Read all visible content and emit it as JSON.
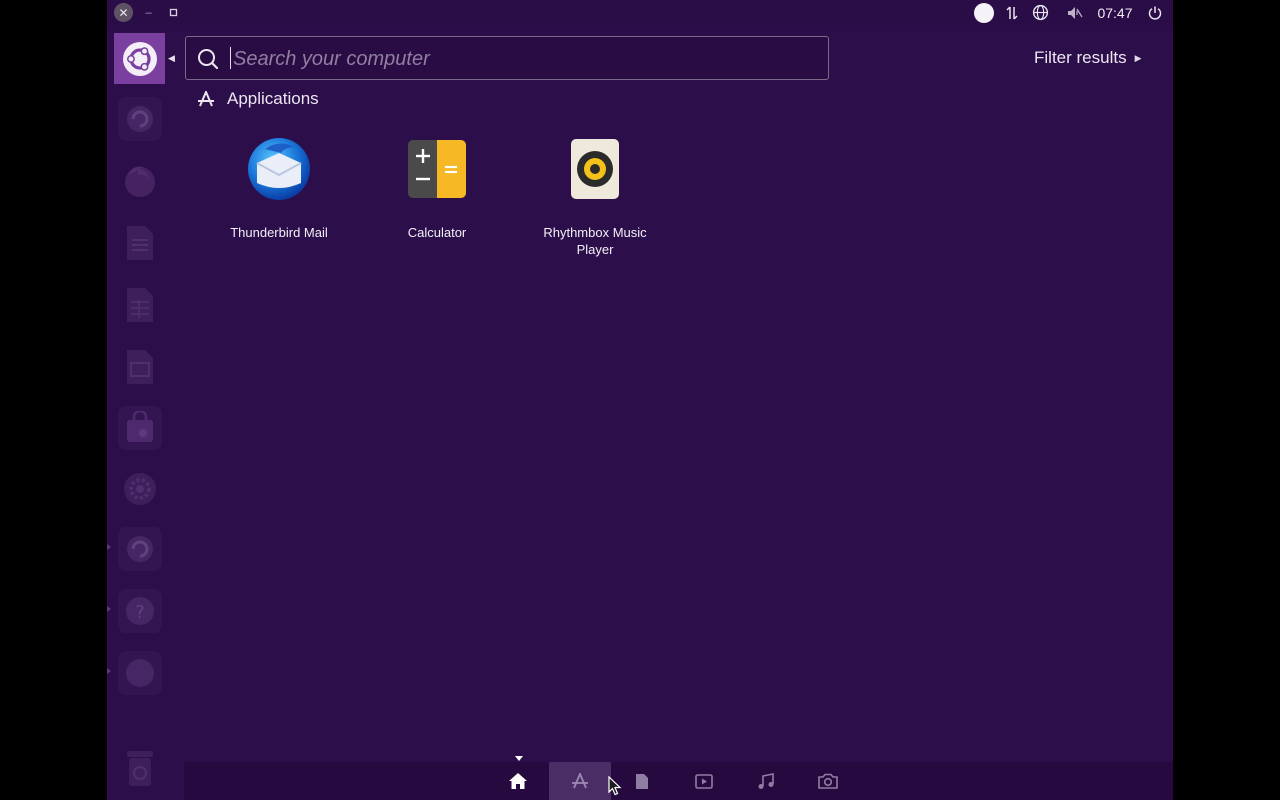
{
  "top_panel": {
    "clock": "07:47",
    "window_buttons": [
      "close",
      "minimize",
      "restore"
    ],
    "tray_icons": [
      "indicator-dot-icon",
      "network-icon",
      "globe-icon",
      "volume-muted-icon",
      "power-icon"
    ]
  },
  "search": {
    "placeholder": "Search your computer",
    "value": ""
  },
  "filter": {
    "label": "Filter results"
  },
  "category": {
    "label": "Applications",
    "icon": "applications-icon"
  },
  "apps": [
    {
      "name": "Thunderbird Mail",
      "icon": "thunderbird-icon"
    },
    {
      "name": "Calculator",
      "icon": "calculator-icon"
    },
    {
      "name": "Rhythmbox Music Player",
      "icon": "rhythmbox-icon"
    }
  ],
  "lenses": [
    {
      "name": "home",
      "active": false
    },
    {
      "name": "applications",
      "active": true
    },
    {
      "name": "files",
      "active": false
    },
    {
      "name": "video",
      "active": false
    },
    {
      "name": "music",
      "active": false
    },
    {
      "name": "photos",
      "active": false
    }
  ],
  "launcher": {
    "items": [
      "dash",
      "ubuntu-software",
      "firefox",
      "libreoffice-writer",
      "libreoffice-calc",
      "libreoffice-impress",
      "app-center",
      "settings",
      "software-updater",
      "help",
      "trash"
    ]
  },
  "colors": {
    "background": "#2c0f4a",
    "accent": "#7b3f9f",
    "text": "#f3eff7"
  }
}
